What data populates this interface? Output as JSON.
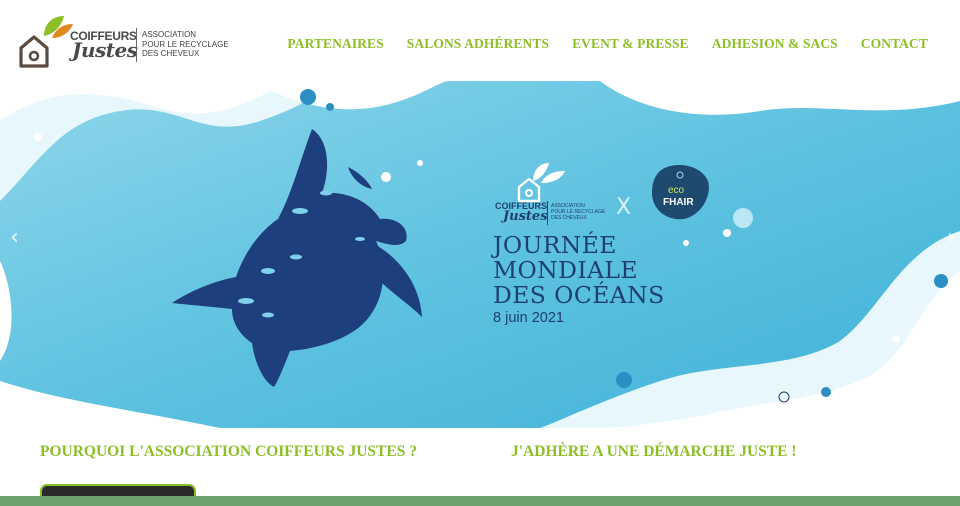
{
  "header": {
    "logo": {
      "word1": "COIFFEURS",
      "word2": "Justes",
      "subtitle_lines": [
        "ASSOCIATION",
        "POUR LE RECYCLAGE",
        "DES CHEVEUX"
      ]
    },
    "nav": [
      "PARTENAIRES",
      "SALONS ADHÉRENTS",
      "EVENT & PRESSE",
      "ADHESION & SACS",
      "CONTACT"
    ]
  },
  "hero": {
    "prev_icon": "chevron-left-icon",
    "next_icon": "chevron-right-icon",
    "partner_logo": {
      "word1": "COIFFEURS",
      "word2": "Justes",
      "subtitle_lines": [
        "ASSOCIATION",
        "POUR LE RECYCLAGE",
        "DES CHEVEUX"
      ]
    },
    "cross": "X",
    "eco_line1": "eco",
    "eco_line2": "FHAIR",
    "title_lines": [
      "JOURNÉE",
      "MONDIALE",
      "DES OCÉANS"
    ],
    "date": "8 juin 2021"
  },
  "sections": {
    "left_heading": "POURQUOI L'ASSOCIATION COIFFEURS JUSTES ?",
    "right_heading": "J'ADHÈRE A UNE DÉMARCHE JUSTE !"
  },
  "colors": {
    "accent_green": "#8cbf26",
    "navy": "#1f3f6e",
    "ocean": "#5ec2e0",
    "footer_green": "#6aa46c"
  }
}
